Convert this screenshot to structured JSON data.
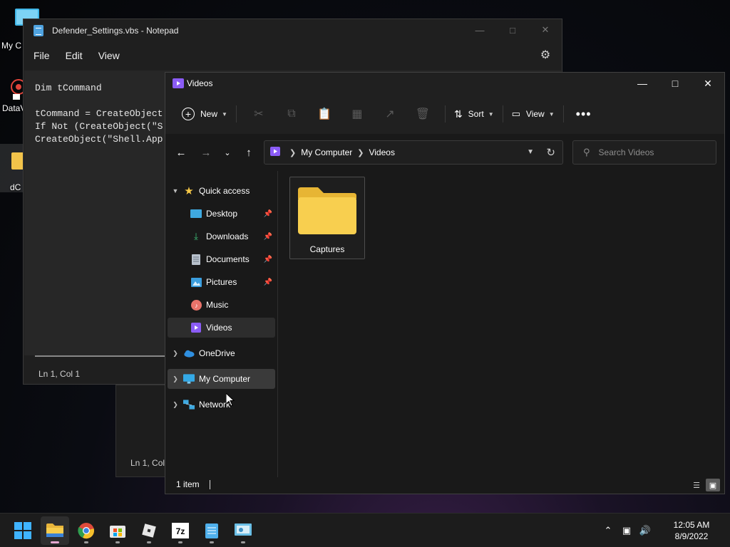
{
  "desktop": {
    "icons": [
      {
        "label": "My C"
      },
      {
        "label": "DataV"
      },
      {
        "label": "dC"
      }
    ]
  },
  "notepad": {
    "title": "Defender_Settings.vbs - Notepad",
    "menu": [
      "File",
      "Edit",
      "View"
    ],
    "code": "Dim tCommand\n\ntCommand = CreateObject\nIf Not (CreateObject(\"S\nCreateObject(\"Shell.App",
    "status": "Ln 1, Col 1"
  },
  "notepad_back": {
    "status": "Ln 1, Col"
  },
  "explorer": {
    "title": "Videos",
    "toolbar": {
      "new_label": "New",
      "sort_label": "Sort",
      "view_label": "View"
    },
    "breadcrumb": [
      "My Computer",
      "Videos"
    ],
    "search_placeholder": "Search Videos",
    "nav": {
      "quick_access": "Quick access",
      "items": [
        {
          "label": "Desktop",
          "pinned": true
        },
        {
          "label": "Downloads",
          "pinned": true
        },
        {
          "label": "Documents",
          "pinned": true
        },
        {
          "label": "Pictures",
          "pinned": true
        },
        {
          "label": "Music",
          "pinned": false
        },
        {
          "label": "Videos",
          "pinned": false
        }
      ],
      "onedrive": "OneDrive",
      "my_computer": "My Computer",
      "network": "Network"
    },
    "folders": [
      {
        "name": "Captures"
      }
    ],
    "status": "1 item"
  },
  "taskbar": {
    "time": "12:05 AM",
    "date": "8/9/2022"
  },
  "colors": {
    "accent": "#4cc2ff",
    "folder_yellow": "#f8cf4f",
    "video_purple": "#8b5cf6"
  }
}
